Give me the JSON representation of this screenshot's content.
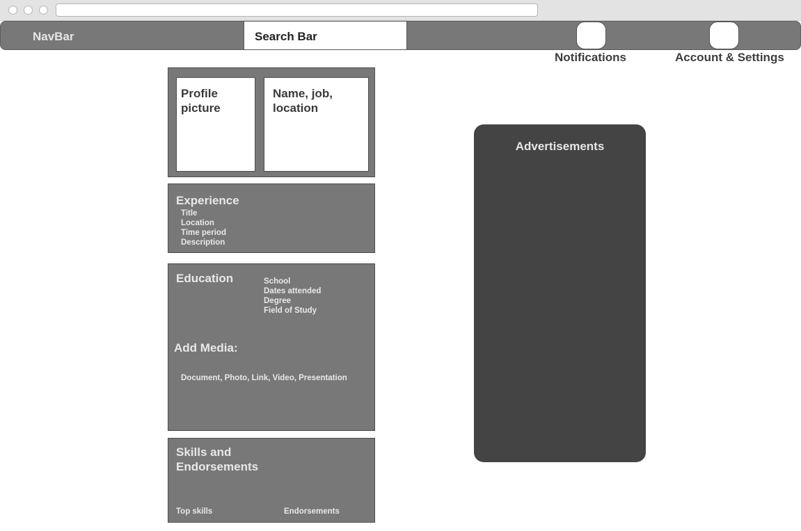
{
  "navbar": {
    "title": "NavBar",
    "search_label": "Search Bar",
    "notifications_label": "Notifications",
    "account_label": "Account & Settings"
  },
  "profile": {
    "picture_label": "Profile picture",
    "info_label": "Name, job, location"
  },
  "experience": {
    "title": "Experience",
    "items": [
      "Title",
      "Location",
      "Time period",
      "Description"
    ]
  },
  "education": {
    "title": "Education",
    "items": [
      "School",
      "Dates attended",
      "Degree",
      "Field of Study"
    ],
    "media_title": "Add Media:",
    "media_types": "Document, Photo, Link, Video, Presentation"
  },
  "skills": {
    "title": "Skills and Endorsements",
    "top_skills_label": "Top skills",
    "endorsements_label": "Endorsements"
  },
  "ads": {
    "title": "Advertisements"
  }
}
